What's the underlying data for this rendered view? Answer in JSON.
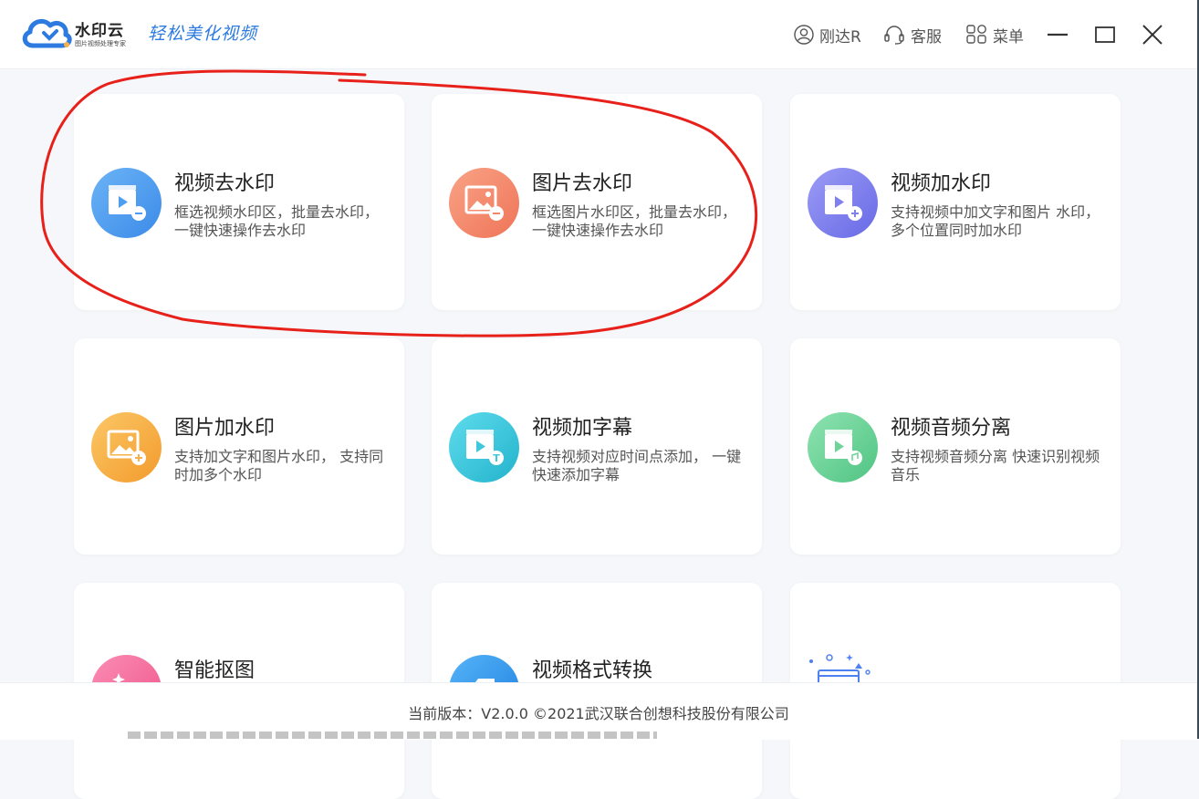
{
  "app": {
    "name": "水印云",
    "subtitle": "图片视频处理专家",
    "slogan": "轻松美化视频",
    "brand_color": "#2d7be0"
  },
  "toolbar": {
    "user_label": "刚达R",
    "service_label": "客服",
    "menu_label": "菜单",
    "user_icon": "user-icon",
    "service_icon": "headset-icon",
    "menu_icon": "grid-icon"
  },
  "cards": [
    {
      "title": "视频去水印",
      "desc": "框选视频水印区，批量去水印， 一键快速操作去水印",
      "icon": "video-remove-icon",
      "color": "#4d9ef0"
    },
    {
      "title": "图片去水印",
      "desc": "框选图片水印区，批量去水印， 一键快速操作去水印",
      "icon": "image-remove-icon",
      "color": "#f4876a"
    },
    {
      "title": "视频加水印",
      "desc": "支持视频中加文字和图片 水印，多个位置同时加水印",
      "icon": "video-add-icon",
      "color": "#7f80ee"
    },
    {
      "title": "图片加水印",
      "desc": "支持加文字和图片水印， 支持同时加多个水印",
      "icon": "image-add-icon",
      "color": "#f7b14a"
    },
    {
      "title": "视频加字幕",
      "desc": "支持视频对应时间点添加， 一键快速添加字幕",
      "icon": "video-subtitle-icon",
      "color": "#3ec8dc"
    },
    {
      "title": "视频音频分离",
      "desc": "支持视频音频分离 快速识别视频音乐",
      "icon": "video-audio-icon",
      "color": "#6fd39a"
    },
    {
      "title": "智能抠图",
      "desc": "",
      "icon": "cutout-icon",
      "color": "#f56c9c"
    },
    {
      "title": "视频格式转换",
      "desc": "",
      "icon": "format-convert-icon",
      "color": "#2f95f0"
    },
    {
      "title": "",
      "desc": "",
      "icon": "more-coming-icon",
      "color": "#4d80f0"
    }
  ],
  "footer": {
    "text": "当前版本：V2.0.0 ©2021武汉联合创想科技股份有限公司"
  },
  "annotation_color": "#e8201a"
}
